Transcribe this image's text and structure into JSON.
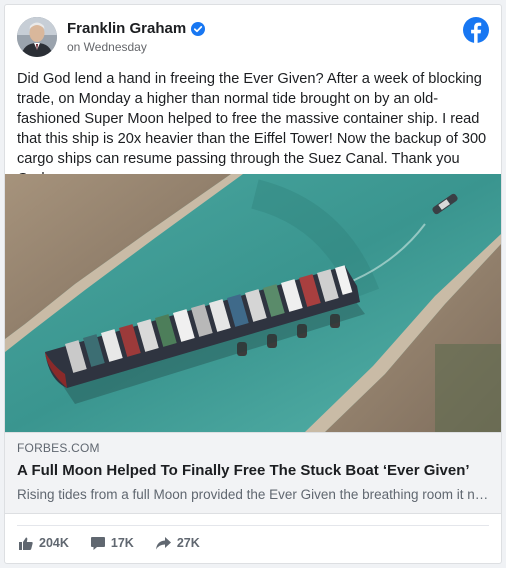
{
  "post": {
    "author": "Franklin Graham",
    "timestamp": "on Wednesday",
    "text": "Did God lend a hand in freeing the Ever Given? After a week of blocking trade, on Monday a higher than normal tide brought on by an old-fashioned Super Moon helped to free the massive container ship. I read that this ship is 20x heavier than the Eiffel Tower! Now the backup of 300 cargo ships can resume passing through the Suez Canal. Thank you God."
  },
  "link_preview": {
    "domain": "FORBES.COM",
    "title": "A Full Moon Helped To Finally Free The Stuck Boat ‘Ever Given’",
    "description": "Rising tides from a full Moon provided the Ever Given the breathing room it needed"
  },
  "stats": {
    "likes": "204K",
    "comments": "17K",
    "shares": "27K"
  },
  "icons": {
    "verified": "verified-badge-icon",
    "brand": "facebook-logo-icon",
    "like": "thumbs-up-icon",
    "comment": "comment-icon",
    "share": "share-arrow-icon"
  },
  "colors": {
    "facebook_blue": "#1877f2",
    "text_primary": "#1c1e21",
    "text_secondary": "#65676b",
    "link_background": "#f2f3f5"
  }
}
